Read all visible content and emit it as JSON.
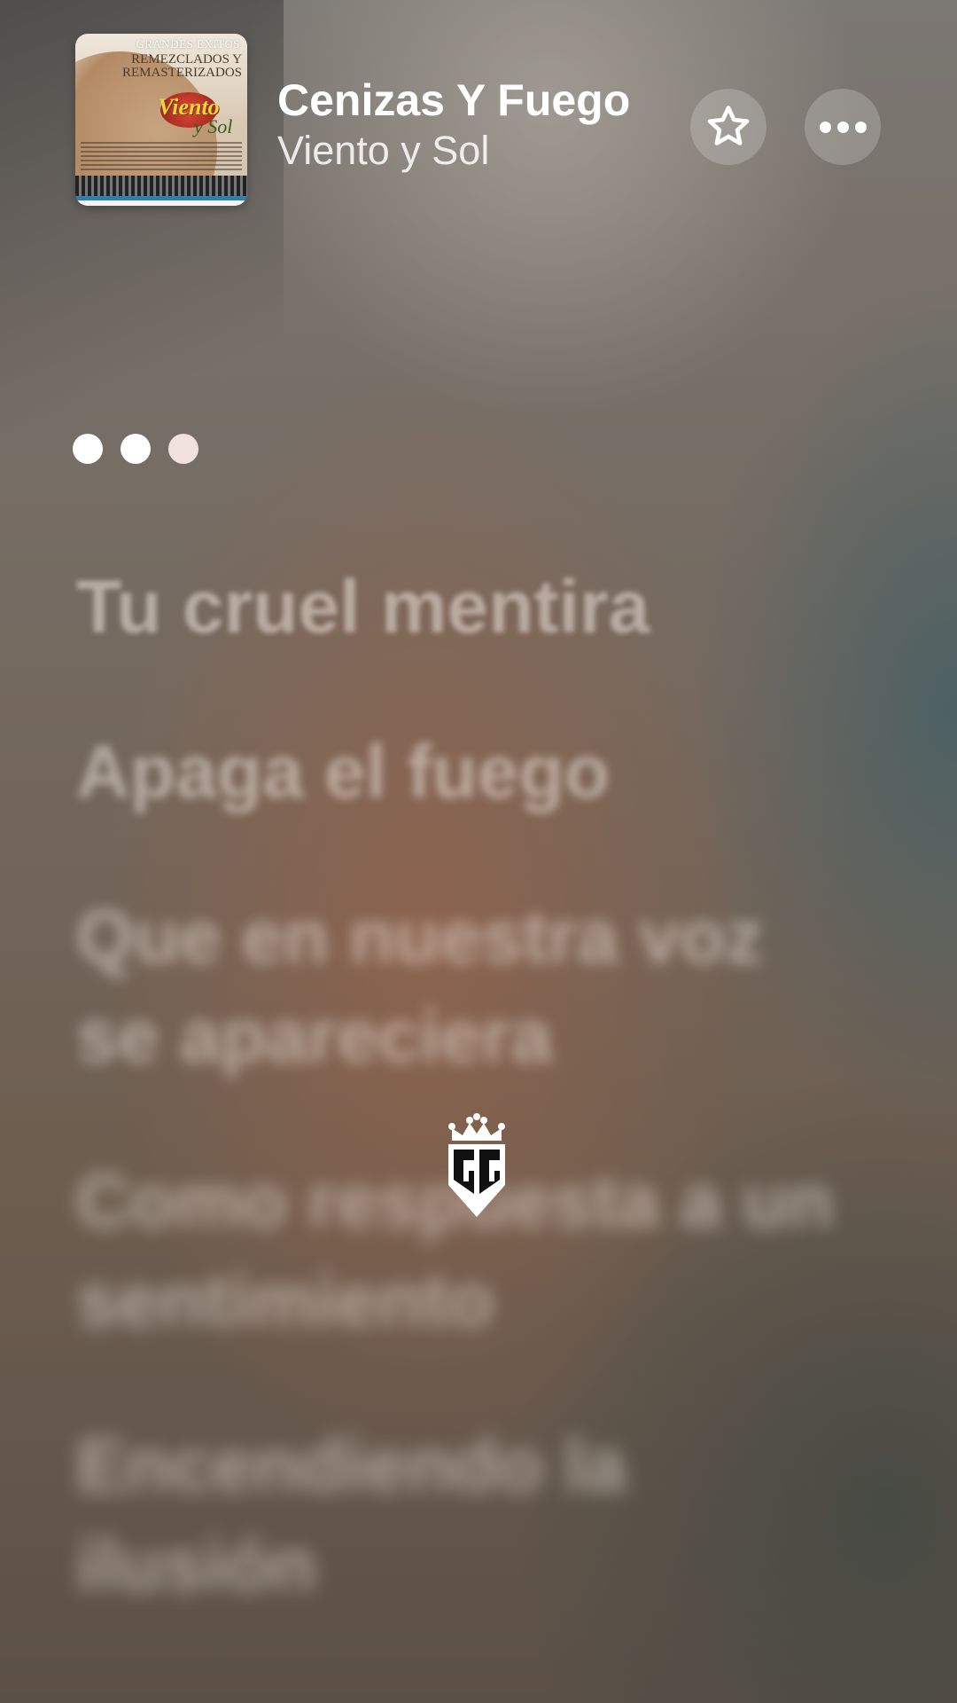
{
  "now_playing": {
    "title": "Cenizas Y Fuego",
    "artist": "Viento y Sol",
    "artwork": {
      "header": "GRANDES EXITOS",
      "subtitle": "REMEZCLADOS Y REMASTERIZADOS",
      "logo_main": "Viento",
      "logo_sub": "y Sol"
    }
  },
  "actions": {
    "favorite_icon": "star-icon",
    "more_icon": "more-icon"
  },
  "lyrics": {
    "lines": [
      "Tu cruel mentira",
      "Apaga el fuego",
      "Que en nuestra voz se apareciera",
      "Como respuesta a un sentimiento",
      "Encendiendo la ilusión"
    ]
  },
  "colors": {
    "text": "#ffffff",
    "button_bg": "rgba(255,255,255,0.2)",
    "lyric_dim": "rgba(235,225,218,0.55)"
  },
  "watermark": {
    "text": "GG"
  }
}
